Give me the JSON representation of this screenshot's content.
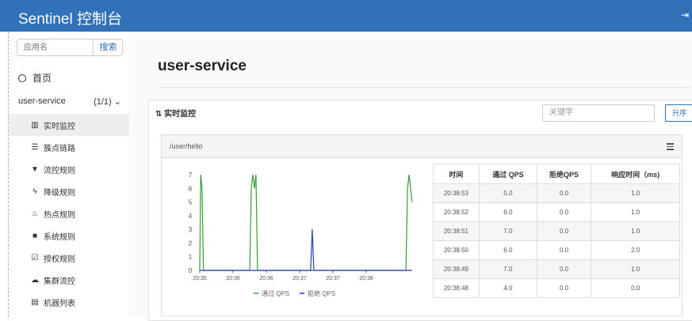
{
  "header": {
    "brand": "Sentinel 控制台",
    "logout_icon": "logout-icon"
  },
  "sidebar": {
    "search_placeholder": "应用名",
    "search_button": "搜索",
    "home_label": "首页",
    "app_name": "user-service",
    "app_count": "(1/1)",
    "items": [
      {
        "label": "实时监控",
        "icon": "chart-icon"
      },
      {
        "label": "簇点链路",
        "icon": "list-icon"
      },
      {
        "label": "流控规则",
        "icon": "filter-icon"
      },
      {
        "label": "降级规则",
        "icon": "bolt-icon"
      },
      {
        "label": "热点规则",
        "icon": "fire-icon"
      },
      {
        "label": "系统规则",
        "icon": "lock-icon"
      },
      {
        "label": "授权规则",
        "icon": "check-icon"
      },
      {
        "label": "集群流控",
        "icon": "cloud-icon"
      },
      {
        "label": "机器列表",
        "icon": "table-icon"
      }
    ]
  },
  "main": {
    "title": "user-service",
    "panel_title": "实时监控",
    "keyword_placeholder": "关键字",
    "sort_button": "升序",
    "resource": "/user/hello"
  },
  "chart_data": {
    "type": "line",
    "x_ticks": [
      "20:35",
      "20:36",
      "20:36",
      "20:37",
      "20:37",
      "20:38"
    ],
    "y_ticks": [
      0,
      1,
      2,
      3,
      4,
      5,
      6,
      7
    ],
    "ylim": [
      0,
      7
    ],
    "series": [
      {
        "name": "通过 QPS",
        "color": "#3a9a3a",
        "points": [
          [
            0,
            0
          ],
          [
            0.3,
            7
          ],
          [
            0.7,
            6
          ],
          [
            1.2,
            0
          ],
          [
            16,
            0
          ],
          [
            16.5,
            6
          ],
          [
            17,
            7
          ],
          [
            17.5,
            6
          ],
          [
            18,
            7
          ],
          [
            18.5,
            0
          ],
          [
            31,
            0
          ],
          [
            66,
            0
          ],
          [
            66.5,
            6
          ],
          [
            67,
            7
          ],
          [
            67.5,
            6
          ],
          [
            68,
            5
          ]
        ]
      },
      {
        "name": "拒绝 QPS",
        "color": "#2b3bbf",
        "points": [
          [
            0,
            0
          ],
          [
            35.5,
            0
          ],
          [
            36,
            3
          ],
          [
            36.5,
            0
          ],
          [
            68,
            0
          ]
        ]
      }
    ]
  },
  "table": {
    "headers": [
      "时间",
      "通过 QPS",
      "拒绝QPS",
      "响应时间（ms)"
    ],
    "rows": [
      [
        "20:38:53",
        "5.0",
        "0.0",
        "1.0"
      ],
      [
        "20:38:52",
        "6.0",
        "0.0",
        "1.0"
      ],
      [
        "20:38:51",
        "7.0",
        "0.0",
        "1.0"
      ],
      [
        "20:38:50",
        "6.0",
        "0.0",
        "2.0"
      ],
      [
        "20:38:49",
        "7.0",
        "0.0",
        "1.0"
      ],
      [
        "20:38:48",
        "4.0",
        "0.0",
        "0.0"
      ]
    ]
  }
}
